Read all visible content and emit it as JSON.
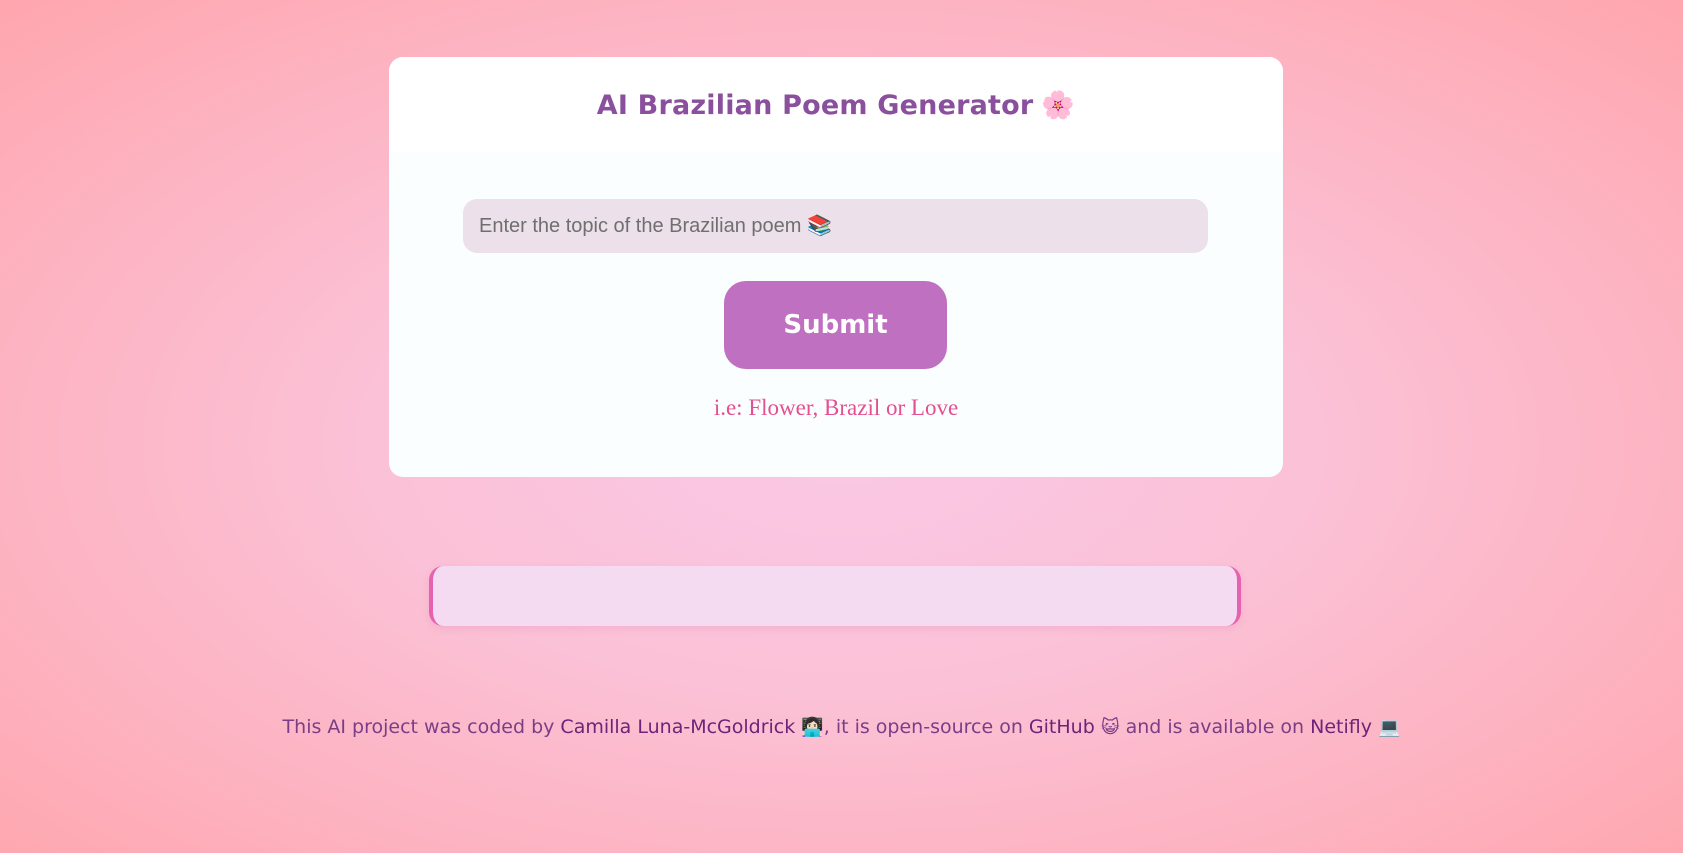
{
  "header": {
    "title": "AI Brazilian Poem Generator",
    "title_emoji": "🌸"
  },
  "form": {
    "placeholder": "Enter the topic of the Brazilian poem 📚",
    "submit_label": "Submit",
    "hint": "i.e: Flower, Brazil or Love"
  },
  "poem": {
    "text": ""
  },
  "footer": {
    "text_before": "This AI project was coded by ",
    "author_link": "Camilla Luna-McGoldrick",
    "author_emoji": "👩🏻‍💻",
    "text_middle": ", it is open-source on ",
    "github_link": "GitHub",
    "github_emoji": "😺",
    "text_after": " and is available on ",
    "netlify_link": "Netifly",
    "netlify_emoji": "💻"
  },
  "colors": {
    "title": "#8a4f9d",
    "button": "#bf70c0",
    "hint": "#e44f91",
    "poem_border": "#e661b0",
    "poem_background": "#f4dbf1"
  },
  "icons": {
    "title_icon": "cherry-blossom-icon",
    "author_icon": "technologist-icon",
    "github_icon": "cat-icon",
    "netlify_icon": "laptop-icon"
  }
}
